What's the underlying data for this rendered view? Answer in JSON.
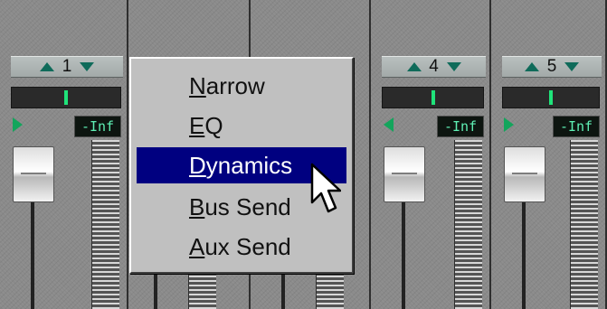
{
  "channels": [
    {
      "number": "1",
      "level": "-Inf",
      "play_dir": "right"
    },
    {
      "number": "",
      "level": "",
      "play_dir": "right"
    },
    {
      "number": "",
      "level": "",
      "play_dir": "right"
    },
    {
      "number": "4",
      "level": "-Inf",
      "play_dir": "left"
    },
    {
      "number": "5",
      "level": "-Inf",
      "play_dir": "right"
    }
  ],
  "menu": {
    "items": [
      {
        "first": "N",
        "rest": "arrow"
      },
      {
        "first": "E",
        "rest": "Q"
      },
      {
        "first": "D",
        "rest": "ynamics"
      },
      {
        "first": "B",
        "rest": "us Send"
      },
      {
        "first": "A",
        "rest": "ux Send"
      }
    ],
    "selected_index": 2
  },
  "colors": {
    "menu_highlight": "#000080",
    "arrow_green": "#0f6b5a",
    "meter_tick": "#1fe37a",
    "readout_text": "#5ff0b4"
  },
  "icons": {
    "up": "triangle-up",
    "down": "triangle-down",
    "play": "triangle-right",
    "cursor": "arrow-pointer"
  }
}
